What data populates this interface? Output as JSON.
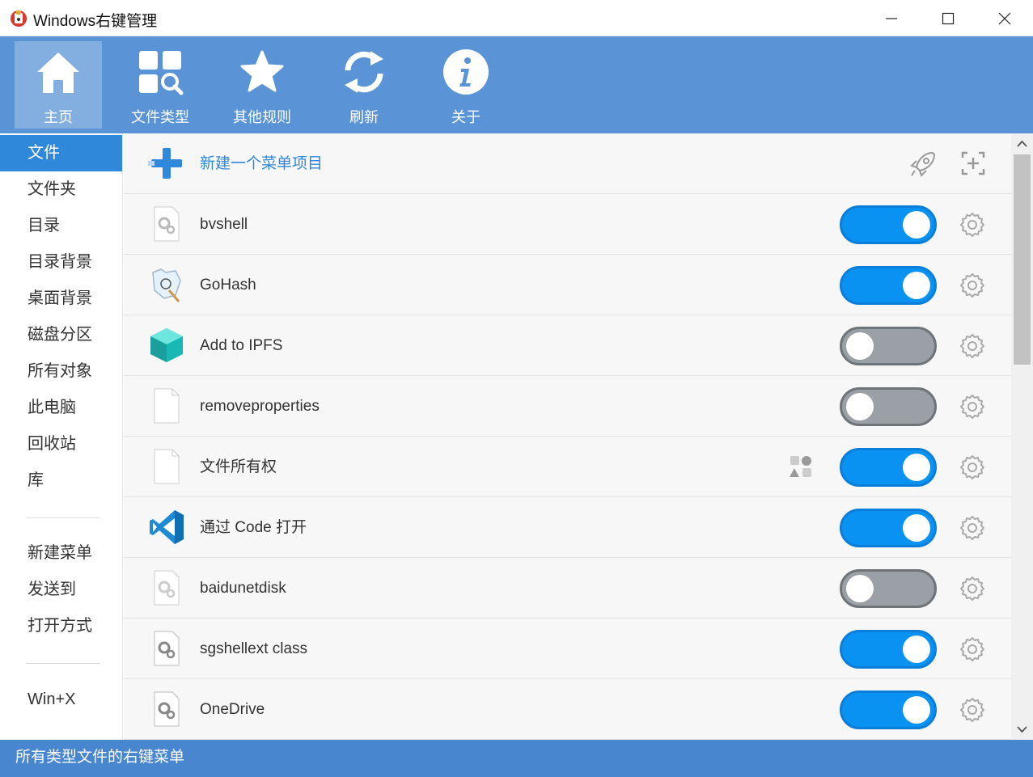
{
  "window": {
    "title": "Windows右键管理",
    "controls": [
      "minimize",
      "maximize",
      "close"
    ]
  },
  "toolbar": {
    "items": [
      {
        "label": "主页",
        "icon": "home-icon",
        "active": true
      },
      {
        "label": "文件类型",
        "icon": "file-types-icon",
        "active": false
      },
      {
        "label": "其他规则",
        "icon": "star-icon",
        "active": false
      },
      {
        "label": "刷新",
        "icon": "refresh-icon",
        "active": false
      },
      {
        "label": "关于",
        "icon": "info-icon",
        "active": false
      }
    ]
  },
  "sidebar": {
    "items": [
      {
        "label": "文件",
        "active": true
      },
      {
        "label": "文件夹"
      },
      {
        "label": "目录"
      },
      {
        "label": "目录背景"
      },
      {
        "label": "桌面背景"
      },
      {
        "label": "磁盘分区"
      },
      {
        "label": "所有对象"
      },
      {
        "label": "此电脑"
      },
      {
        "label": "回收站"
      },
      {
        "label": "库"
      },
      {
        "label": "新建菜单"
      },
      {
        "label": "发送到"
      },
      {
        "label": "打开方式"
      },
      {
        "label": "Win+X"
      }
    ]
  },
  "main": {
    "new_item_label": "新建一个菜单项目",
    "rows": [
      {
        "label": "bvshell",
        "icon": "gear-file-icon",
        "enabled": true
      },
      {
        "label": "GoHash",
        "icon": "gohash-icon",
        "enabled": true
      },
      {
        "label": "Add to IPFS",
        "icon": "ipfs-cube-icon",
        "enabled": false
      },
      {
        "label": "removeproperties",
        "icon": "blank-file-icon",
        "enabled": false
      },
      {
        "label": "文件所有权",
        "icon": "blank-file-icon",
        "enabled": true,
        "extra_icon": "shapes-icon"
      },
      {
        "label": "通过 Code 打开",
        "icon": "vscode-icon",
        "enabled": true
      },
      {
        "label": "baidunetdisk",
        "icon": "gear-file-icon",
        "enabled": false
      },
      {
        "label": "sgshellext class",
        "icon": "gear-file-icon",
        "enabled": true
      },
      {
        "label": "OneDrive",
        "icon": "gear-file-icon",
        "enabled": true
      }
    ]
  },
  "statusbar": {
    "text": "所有类型文件的右键菜单"
  },
  "colors": {
    "toolbar_bg": "#5a93d6",
    "accent": "#2f88d9",
    "toggle_on": "#0a92f2",
    "toggle_off": "#9aa0a6",
    "status_bg": "#4886cf"
  }
}
